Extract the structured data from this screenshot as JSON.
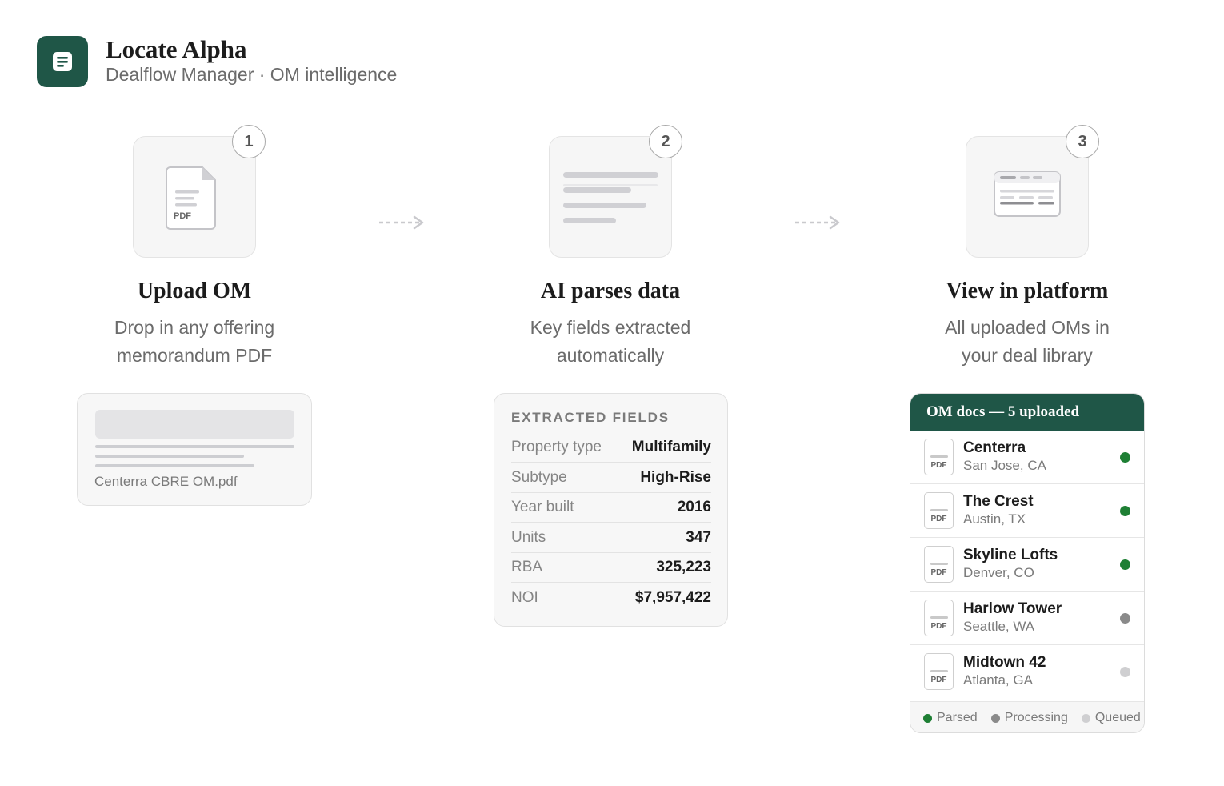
{
  "brand": {
    "title": "Locate Alpha",
    "subtitle": "Dealflow Manager · OM intelligence",
    "logo_icon": "document-lines-icon",
    "color": "#1f5647"
  },
  "steps": [
    {
      "number": "1",
      "title": "Upload OM",
      "desc_line1": "Drop in any offering",
      "desc_line2": "memorandum PDF",
      "icon": "pdf-file-icon"
    },
    {
      "number": "2",
      "title": "AI parses data",
      "desc_line1": "Key fields extracted",
      "desc_line2": "automatically",
      "icon": "text-lines-icon"
    },
    {
      "number": "3",
      "title": "View in platform",
      "desc_line1": "All uploaded OMs in",
      "desc_line2": "your deal library",
      "icon": "dashboard-window-icon"
    }
  ],
  "upload_card": {
    "file_name": "Centerra CBRE OM.pdf",
    "pdf_label": "PDF"
  },
  "extracted": {
    "heading": "EXTRACTED FIELDS",
    "fields": [
      {
        "label": "Property type",
        "value": "Multifamily"
      },
      {
        "label": "Subtype",
        "value": "High-Rise"
      },
      {
        "label": "Year built",
        "value": "2016"
      },
      {
        "label": "Units",
        "value": "347"
      },
      {
        "label": "RBA",
        "value": "325,223"
      },
      {
        "label": "NOI",
        "value": "$7,957,422"
      }
    ]
  },
  "library": {
    "header": "OM docs — 5 uploaded",
    "docs": [
      {
        "name": "Centerra",
        "location": "San Jose, CA",
        "status": "parsed",
        "pdf_label": "PDF"
      },
      {
        "name": "The Crest",
        "location": "Austin, TX",
        "status": "parsed",
        "pdf_label": "PDF"
      },
      {
        "name": "Skyline Lofts",
        "location": "Denver, CO",
        "status": "parsed",
        "pdf_label": "PDF"
      },
      {
        "name": "Harlow Tower",
        "location": "Seattle, WA",
        "status": "processing",
        "pdf_label": "PDF"
      },
      {
        "name": "Midtown 42",
        "location": "Atlanta, GA",
        "status": "queued",
        "pdf_label": "PDF"
      }
    ],
    "legend": [
      {
        "label": "Parsed",
        "status": "parsed"
      },
      {
        "label": "Processing",
        "status": "processing"
      },
      {
        "label": "Queued",
        "status": "queued"
      }
    ],
    "status_colors": {
      "parsed": "#1e7f34",
      "processing": "#8a8a8a",
      "queued": "#cfcfd1"
    }
  }
}
